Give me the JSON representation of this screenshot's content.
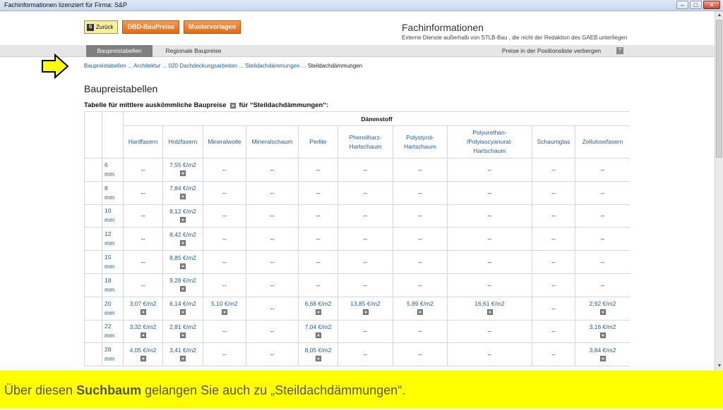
{
  "window": {
    "title": "Fachinformationen lizenziert für Firma: S&P"
  },
  "toolbar": {
    "back_label": "Zurück",
    "dbd_label": "DBD-BauPreise",
    "muster_label": "Mustervorlagen"
  },
  "header": {
    "title": "Fachinformationen",
    "subtitle": "Externe Dienste außerhalb von  STLB-Bau , die nicht der Redaktion des GAEB unterliegen"
  },
  "tabs": [
    {
      "label": "Baupreistabellen",
      "active": true
    },
    {
      "label": "Regionale Baupreise",
      "active": false
    }
  ],
  "tabbar_right": {
    "hide_prices": "Preise in der Positionsliste verbergen",
    "help": "?"
  },
  "breadcrumb": {
    "links": [
      "Baupreistabellen",
      "Architektur",
      "020 Dachdeckungsarbeiten",
      "Steildachdämmungen"
    ],
    "separator": " ... ",
    "current": "Steildachdämmungen"
  },
  "page": {
    "heading": "Baupreistabellen",
    "table_title_pre": "Tabelle für mittlere auskömmliche Baupreise",
    "table_title_post": "für “Steildachdämmungen“:"
  },
  "table": {
    "group_header": "Dämmstoff",
    "columns": [
      [
        "Hanffasern"
      ],
      [
        "Holzfasern"
      ],
      [
        "Mineralwolle"
      ],
      [
        "Mineralschaum"
      ],
      [
        "Perlite"
      ],
      [
        "Phenolharz-",
        "Hartschaum"
      ],
      [
        "Polystyrol-",
        "Hartschaum"
      ],
      [
        "Polyurethan-",
        "/Polyisocyanurat-",
        "Hartschaum"
      ],
      [
        "Schaumglas"
      ],
      [
        "Zellulosefasern"
      ]
    ],
    "rows": [
      {
        "size": [
          "6",
          "mm"
        ],
        "cells": [
          "--",
          "7,55 €/m2",
          "--",
          "--",
          "--",
          "--",
          "--",
          "--",
          "--",
          "--"
        ]
      },
      {
        "size": [
          "8",
          "mm"
        ],
        "cells": [
          "--",
          "7,84 €/m2",
          "--",
          "--",
          "--",
          "--",
          "--",
          "--",
          "--",
          "--"
        ]
      },
      {
        "size": [
          "10",
          "mm"
        ],
        "cells": [
          "--",
          "8,12 €/m2",
          "--",
          "--",
          "--",
          "--",
          "--",
          "--",
          "--",
          "--"
        ]
      },
      {
        "size": [
          "12",
          "mm"
        ],
        "cells": [
          "--",
          "8,42 €/m2",
          "--",
          "--",
          "--",
          "--",
          "--",
          "--",
          "--",
          "--"
        ]
      },
      {
        "size": [
          "15",
          "mm"
        ],
        "cells": [
          "--",
          "8,85 €/m2",
          "--",
          "--",
          "--",
          "--",
          "--",
          "--",
          "--",
          "--"
        ]
      },
      {
        "size": [
          "18",
          "mm"
        ],
        "cells": [
          "--",
          "9,28 €/m2",
          "--",
          "--",
          "--",
          "--",
          "--",
          "--",
          "--",
          "--"
        ]
      },
      {
        "size": [
          "20",
          "mm"
        ],
        "cells": [
          "3,07 €/m2",
          "6,14 €/m2",
          "5,10 €/m2",
          "--",
          "6,68 €/m2",
          "13,85 €/m2",
          "5,89 €/m2",
          "16,61 €/m2",
          "--",
          "2,92 €/m2"
        ]
      },
      {
        "size": [
          "22",
          "mm"
        ],
        "cells": [
          "3,32 €/m2",
          "2,81 €/m2",
          "--",
          "--",
          "7,04 €/m2",
          "--",
          "--",
          "--",
          "--",
          "3,16 €/m2"
        ]
      },
      {
        "size": [
          "28",
          "mm"
        ],
        "cells": [
          "4,05 €/m2",
          "3,41 €/m2",
          "--",
          "--",
          "8,05 €/m2",
          "--",
          "--",
          "--",
          "--",
          "3,84 €/m2"
        ]
      }
    ]
  },
  "caption": {
    "pre": "Über diesen ",
    "bold": "Suchbaum",
    "post": " gelangen Sie auch zu „Steildachdämmungen“."
  },
  "colors": {
    "accent_orange": "#e26a12",
    "link_blue": "#1f5c9c",
    "caption_yellow": "#ffff00",
    "tab_active": "#7f7f7f"
  },
  "icons": [
    "arrow-right-icon",
    "info-icon",
    "back-icon",
    "help-icon"
  ]
}
